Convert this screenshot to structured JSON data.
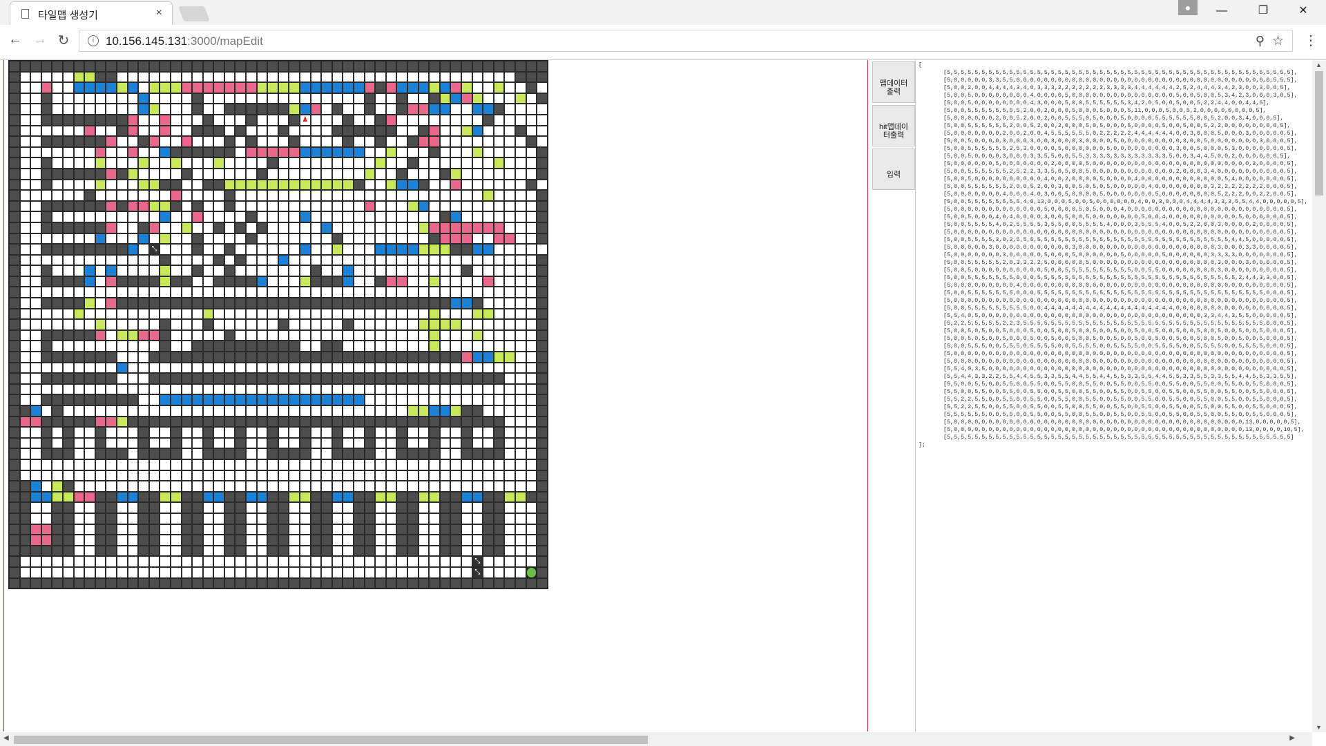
{
  "browser": {
    "tab_title": "타일맵 생성기",
    "tab_close": "×",
    "url_host": "10.156.145.131",
    "url_path": ":3000/mapEdit",
    "win_min": "—",
    "win_max": "❐",
    "win_close": "✕",
    "nav_back": "←",
    "nav_fwd": "→",
    "nav_reload": "↻",
    "menu": "⋮",
    "zoom_icon": "⚲",
    "star_icon": "☆"
  },
  "buttons": {
    "map_data_output": "맵데이터출력",
    "hit_map_data_output": "hit맵데이터출력",
    "input": "입력"
  },
  "output": {
    "open_bracket": "[",
    "close_bracket": "];",
    "rows": [
      "[5,5,5,5,5,5,5,5,5,5,5,5,5,5,5,5,5,5,5,5,5,5,5,5,5,5,5,5,5,5,5,5,5,5,5,5,5,5,5,5,5,5,5,5,5,5,5,5,5,5],",
      "[5,0,0,0,0,0,3,3,5,5,0,0,0,0,0,0,0,0,0,0,0,0,0,0,0,0,0,0,0,0,0,0,0,0,0,0,0,0,0,0,0,0,0,0,0,0,0,5,5,5],",
      "[5,0,0,2,0,0,4,4,4,4,3,4,0,3,3,3,2,2,2,2,2,2,2,3,3,3,3,4,4,4,4,4,4,2,5,2,4,4,4,3,4,2,3,0,0,3,0,0,5],",
      "[5,0,0,5,0,0,0,0,0,0,0,0,4,0,0,0,0,5,0,0,0,0,0,0,0,0,0,0,0,0,0,0,0,5,0,0,5,0,0,5,3,4,2,3,0,0,0,3,0,5],",
      "[5,0,0,5,0,0,0,0,0,0,0,0,4,3,0,0,0,5,0,0,5,5,5,5,5,5,3,4,2,0,5,0,0,5,0,0,5,2,2,4,4,0,0,4,4,5],",
      "[5,0,0,5,5,5,5,5,5,5,5,2,0,0,2,0,0,0,5,0,0,0,5,0,0,0,5,11,0,0,0,5,0,0,5,2,0,0,0,0,0,0,0,0,5],",
      "[5,0,0,0,0,0,0,2,0,0,5,2,0,0,2,0,0,5,5,5,0,5,0,0,0,5,0,0,0,0,5,5,5,5,5,5,0,0,5,2,0,0,3,4,0,0,0,5],",
      "[5,0,0,5,5,5,5,5,5,2,0,0,5,2,0,0,2,0,0,0,5,0,5,0,0,0,5,0,0,0,0,5,0,0,5,0,0,5,2,2,0,0,0,0,0,0,0,0,5],",
      "[5,0,0,0,0,0,0,0,2,0,0,2,0,0,4,5,5,5,5,5,5,0,2,2,2,2,2,4,4,4,4,4,4,0,0,3,0,0,0,5,0,0,0,3,0,0,0,0,0,5],",
      "[5,0,0,5,0,0,0,0,3,0,0,0,3,0,0,3,0,0,0,3,0,0,0,0,5,0,0,0,0,0,0,0,0,0,3,0,0,5,0,0,0,0,0,0,0,3,0,0,0,5],",
      "[5,0,0,5,5,5,5,5,5,2,5,3,0,0,0,0,5,0,0,0,0,0,0,5,0,0,0,0,0,0,0,0,0,3,0,0,5,0,0,0,5,3,0,0,0,0,0,0,0,5],",
      "[5,0,0,5,0,0,0,0,3,0,0,0,3,3,5,5,0,0,5,5,3,3,3,3,3,3,3,3,3,3,3,3,5,0,0,3,4,4,5,0,0,2,0,0,0,0,0,0,5],",
      "[5,0,0,0,0,0,0,5,0,0,0,0,0,0,0,2,0,0,0,0,5,0,0,0,0,0,0,0,0,0,0,0,0,0,0,0,0,0,0,0,0,0,0,0,3,0,0,0,0,5],",
      "[5,0,0,5,5,5,5,5,5,2,5,2,2,3,3,5,0,5,0,0,5,0,0,0,0,0,0,0,0,0,0,0,0,2,0,0,0,3,4,0,0,0,0,0,0,0,0,0,0,5],",
      "[5,0,0,5,0,0,0,0,0,0,0,0,0,0,4,0,0,2,0,0,0,0,5,0,0,0,0,4,0,0,0,0,0,0,0,0,0,0,0,0,5,4,0,0,0,0,0,0,0,5],",
      "[5,0,0,5,5,5,5,5,5,2,0,0,5,2,0,0,3,0,0,5,0,5,0,5,0,0,0,0,0,4,0,0,0,0,0,0,0,0,3,2,2,2,2,2,2,2,0,0,0,5],",
      "[5,0,0,0,0,0,0,0,4,0,0,0,4,0,3,0,0,5,0,0,0,0,5,0,0,0,0,0,0,0,5,0,0,0,0,0,0,0,0,5,2,2,2,0,0,2,2,0,0,5],",
      "[5,0,0,5,5,5,5,5,5,5,5,4,0,13,0,0,0,5,0,0,5,0,0,0,0,0,0,4,0,0,3,0,0,0,4,4,4,4,3,3,3,5,5,4,4,0,0,0,0,0,5],",
      "[5,0,0,0,0,0,0,0,0,0,0,0,0,0,5,0,0,0,0,5,0,5,0,0,0,4,0,0,0,0,0,0,0,0,0,0,0,0,0,0,0,0,0,0,0,0,0,0,0,5],",
      "[5,0,0,5,0,0,0,4,0,4,0,0,0,0,3,0,0,5,0,0,5,0,0,0,0,0,0,0,5,0,0,4,0,0,0,0,0,0,0,0,0,0,5,0,0,0,0,0,0,5],",
      "[5,0,0,5,5,5,5,4,0,2,5,5,5,5,3,5,5,0,0,5,5,5,5,4,0,0,0,3,5,5,5,4,0,0,5,2,2,0,0,3,0,0,0,0,2,0,0,0,0,5],",
      "[5,0,0,0,0,0,0,0,0,0,0,0,0,0,0,0,0,0,0,0,0,0,0,0,0,0,0,0,0,0,0,0,0,0,0,0,0,0,0,0,0,0,0,0,0,0,0,0,0,5],",
      "[5,0,0,5,5,5,5,3,0,2,5,5,5,5,5,5,5,5,5,5,5,5,5,5,5,5,5,5,5,5,5,5,5,5,5,5,5,5,5,5,5,4,4,5,0,0,0,0,0,5],",
      "[5,0,0,0,0,0,3,0,0,0,0,0,0,0,0,0,0,0,3,0,0,0,0,0,0,0,0,0,0,0,0,0,0,0,0,0,0,0,0,3,0,0,0,3,3,0,0,0,0,5],",
      "[5,0,0,0,0,0,0,0,3,0,0,0,0,0,5,0,0,0,5,0,0,0,0,0,0,5,0,0,0,0,0,5,0,0,0,0,0,0,3,3,3,3,0,0,0,0,0,0,0,5],",
      "[5,0,0,5,5,5,5,5,2,0,3,3,2,2,5,0,0,0,0,0,5,0,0,0,0,0,0,0,0,0,0,0,0,0,0,0,0,0,0,3,0,0,0,3,0,0,0,0,0,5],",
      "[5,0,0,5,0,0,0,0,0,0,0,0,0,0,5,0,0,5,5,5,5,5,5,5,5,5,5,0,0,5,5,0,0,0,0,0,0,0,0,3,0,0,0,0,0,0,0,0,0,5],",
      "[5,0,0,5,5,5,5,5,5,5,0,0,0,5,5,5,5,5,5,5,5,5,5,5,5,5,5,5,5,5,5,5,5,5,5,5,5,5,5,5,5,5,2,4,4,3,3,0,0,5],",
      "[5,0,0,0,0,0,0,0,0,0,4,0,0,0,0,0,0,0,0,0,0,0,0,0,0,0,0,0,0,0,0,0,0,0,0,0,0,0,0,0,0,0,0,0,0,0,0,0,0,5],",
      "[5,0,0,5,5,5,5,5,5,5,0,0,0,5,5,5,5,5,5,5,5,5,5,5,5,5,5,5,5,5,5,5,5,5,5,5,5,5,5,5,5,5,5,5,5,5,0,0,0,5],",
      "[5,0,0,0,0,0,0,0,0,0,0,0,0,0,0,0,0,0,0,0,0,0,0,0,0,0,0,0,0,0,0,0,0,0,0,0,0,0,0,0,0,0,0,0,0,0,0,0,0,5],",
      "[5,0,0,5,5,5,5,5,5,5,5,5,0,0,4,4,4,4,4,4,4,4,4,4,4,4,4,4,4,4,4,4,4,0,0,0,0,0,0,0,0,0,0,0,0,0,0,0,0,5],",
      "[5,5,4,0,5,0,0,0,0,0,0,0,0,0,0,0,0,0,0,0,0,0,0,0,0,0,0,0,0,0,0,0,0,0,0,0,0,3,3,4,4,3,5,5,0,0,0,0,0,5],",
      "[5,2,2,5,5,5,5,5,2,2,3,5,5,5,5,5,5,5,5,5,5,5,5,5,5,5,5,5,5,5,5,5,5,5,5,5,5,5,5,5,5,5,5,5,5,5,0,0,0,5],",
      "[5,0,0,5,0,5,0,0,5,0,0,0,5,0,0,5,0,0,5,0,0,5,0,0,5,0,0,5,0,0,5,0,0,5,0,0,5,0,0,5,0,0,5,0,0,5,0,0,0,5],",
      "[5,0,0,5,0,5,0,0,5,0,0,0,5,0,0,5,0,0,5,0,0,5,0,0,5,0,0,5,0,0,5,0,0,5,0,0,5,0,0,5,0,0,5,0,0,5,0,0,0,5],",
      "[5,0,0,5,5,5,0,0,5,5,5,0,5,5,5,5,0,0,5,5,5,5,0,0,5,5,5,5,0,0,5,5,5,5,0,0,5,5,5,5,0,0,5,5,5,5,0,0,0,5],",
      "[5,0,0,0,0,0,0,0,0,0,0,0,0,0,0,0,0,0,0,0,0,0,0,0,0,0,0,0,0,0,0,0,0,0,0,0,0,0,0,0,0,0,0,0,0,0,0,0,0,5],",
      "[5,0,0,0,0,0,0,0,0,0,0,0,0,0,0,0,0,0,0,0,0,0,0,0,0,0,0,0,0,0,0,0,0,0,0,0,0,0,0,0,0,0,0,0,0,0,0,0,0,5],",
      "[5,5,4,0,3,5,0,0,0,0,0,0,0,0,0,0,0,0,0,0,0,0,0,0,0,0,0,0,0,0,0,0,0,0,0,0,0,0,0,0,0,0,0,0,0,0,0,0,0,5],",
      "[5,5,4,4,3,3,2,2,5,5,4,4,5,5,3,3,5,5,4,4,5,5,4,4,5,5,3,3,5,5,4,4,5,5,3,3,5,5,3,3,5,5,4,4,5,5,3,3,5,5],",
      "[5,5,0,0,5,5,0,0,5,5,0,0,5,5,0,0,5,5,0,0,5,5,0,0,5,5,0,0,5,5,0,0,5,5,0,0,5,5,0,0,5,5,0,0,5,5,0,0,0,5],",
      "[5,5,0,0,5,5,0,0,5,5,0,0,5,5,0,0,5,5,0,0,5,5,0,0,5,5,0,0,5,5,0,0,5,5,0,0,5,5,0,0,5,5,0,0,5,5,0,0,0,5],",
      "[5,5,2,2,5,5,0,0,5,5,0,0,5,5,0,0,5,5,0,0,5,5,0,0,5,5,0,0,5,5,0,0,5,5,0,0,5,5,0,0,5,5,0,0,5,5,0,0,0,5],",
      "[5,5,2,2,5,5,0,0,5,5,0,0,5,5,0,0,5,5,0,0,5,5,0,0,5,5,0,0,5,5,0,0,5,5,0,0,5,5,0,0,5,5,0,0,5,5,0,0,0,5],",
      "[5,5,5,5,5,5,0,0,5,5,0,0,5,5,0,0,5,5,0,0,5,5,0,0,5,5,0,0,5,5,0,0,5,5,0,0,5,5,0,0,5,5,0,0,5,5,0,0,0,5],",
      "[5,0,0,0,0,0,0,0,0,0,0,0,0,0,0,0,0,0,0,0,0,0,0,0,0,0,0,0,0,0,0,0,0,0,0,0,0,0,0,0,0,0,0,13,0,0,0,0,0,5],",
      "[5,0,0,0,0,0,0,0,0,0,0,0,0,0,0,0,0,0,0,0,0,0,0,0,0,0,0,0,0,0,0,0,0,0,0,0,0,0,0,0,0,0,0,13,0,0,0,0,10,5],",
      "[5,5,5,5,5,5,5,5,5,5,5,5,5,5,5,5,5,5,5,5,5,5,5,5,5,5,5,5,5,5,5,5,5,5,5,5,5,5,5,5,5,5,5,5,5,5,5,5,5,5]"
    ]
  },
  "colors": {
    "wall": "#4d4d4d",
    "pink": "#e8688a",
    "green": "#c6e85a",
    "blue": "#1b82d8",
    "goal": "#6ac046",
    "frame": "#bb2222"
  }
}
